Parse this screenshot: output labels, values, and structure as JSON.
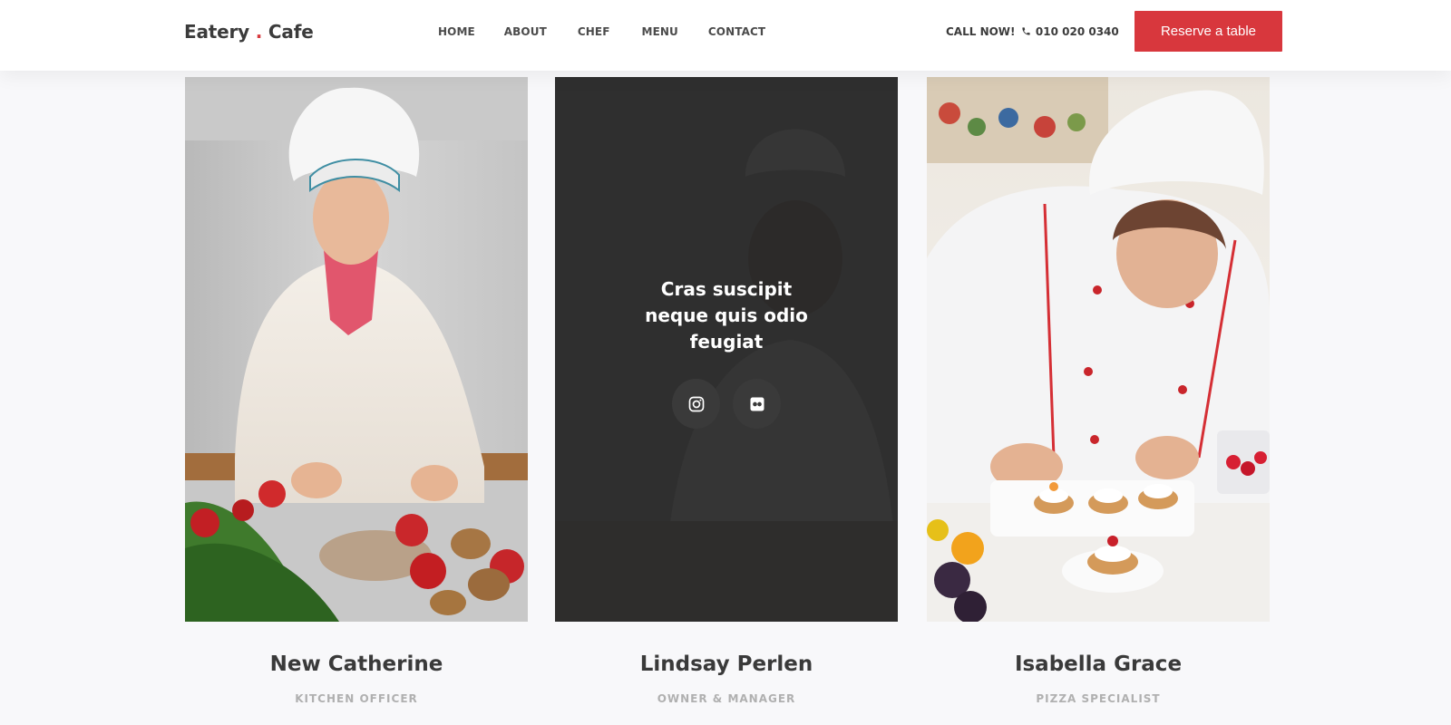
{
  "brand": {
    "name_part1": "Eatery",
    "dot": ".",
    "name_part2": "Cafe"
  },
  "nav": {
    "items": [
      {
        "label": "HOME"
      },
      {
        "label": "ABOUT"
      },
      {
        "label": "CHEF"
      },
      {
        "label": "MENU"
      },
      {
        "label": "CONTACT"
      }
    ]
  },
  "header": {
    "call_label": "CALL NOW!",
    "phone": "010 020 0340",
    "phone_icon": "phone-icon",
    "reserve_label": "Reserve a table"
  },
  "colors": {
    "accent": "#d8373d",
    "overlay": "#282828",
    "page_bg": "#f8f8fa"
  },
  "team": [
    {
      "name": "New Catherine",
      "role": "KITCHEN OFFICER"
    },
    {
      "name": "Lindsay Perlen",
      "role": "OWNER & MANAGER",
      "overlay_text": "Cras suscipit neque quis odio feugiat",
      "socials": [
        {
          "icon": "instagram-icon"
        },
        {
          "icon": "flickr-icon"
        }
      ]
    },
    {
      "name": "Isabella Grace",
      "role": "PIZZA SPECIALIST"
    }
  ]
}
